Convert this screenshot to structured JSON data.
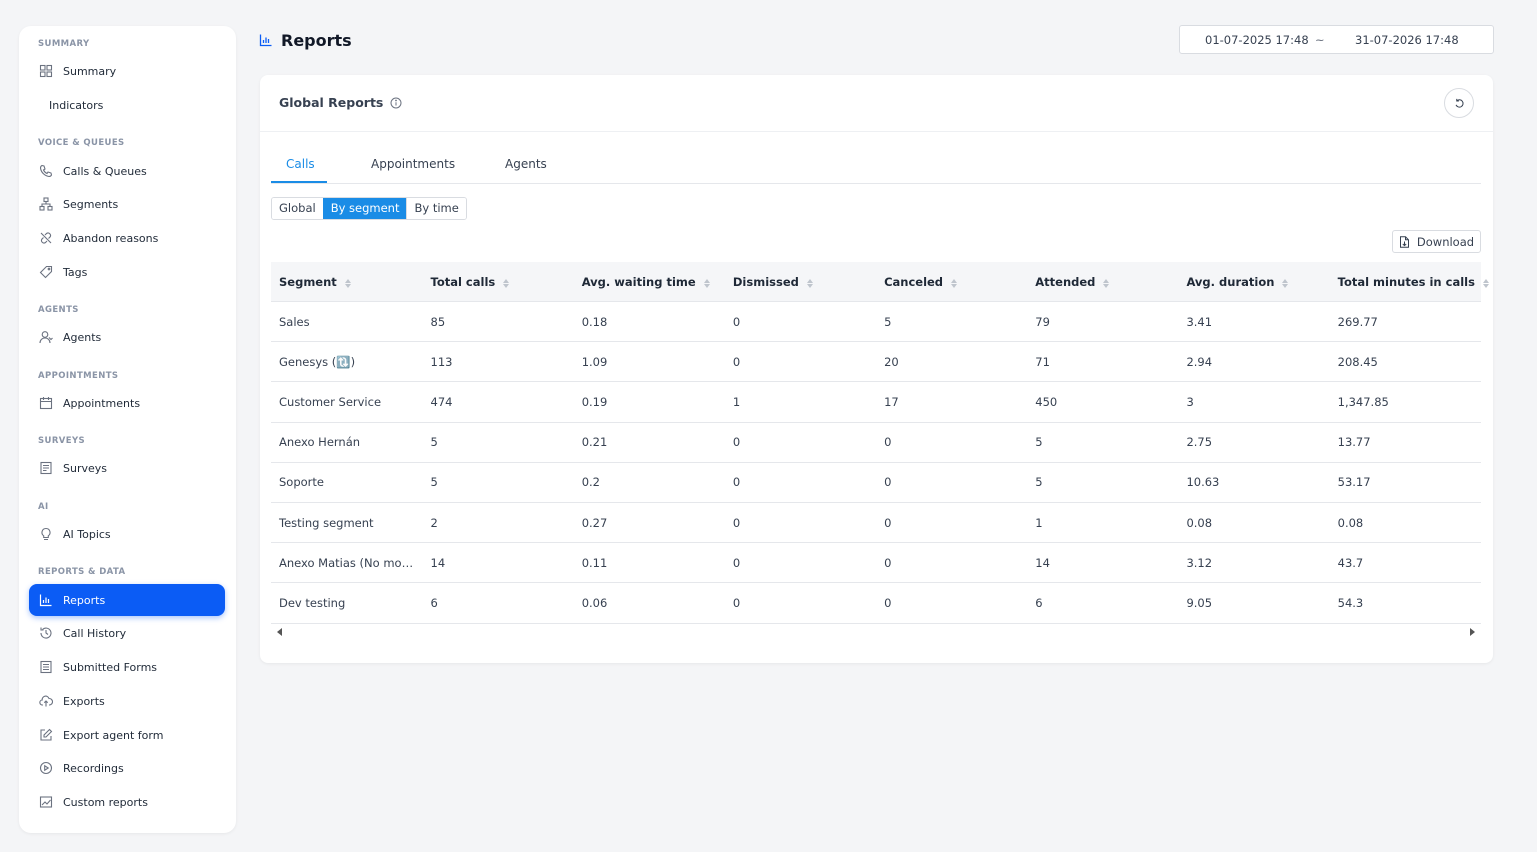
{
  "sidebar": {
    "sections": {
      "summary": "SUMMARY",
      "voice": "VOICE & QUEUES",
      "agents": "AGENTS",
      "appointments": "APPOINTMENTS",
      "surveys": "SURVEYS",
      "ai": "AI",
      "reports": "REPORTS & DATA"
    },
    "items": {
      "summary": "Summary",
      "indicators": "Indicators",
      "calls_queues": "Calls & Queues",
      "segments": "Segments",
      "abandon_reasons": "Abandon reasons",
      "tags": "Tags",
      "agents": "Agents",
      "appointments": "Appointments",
      "surveys": "Surveys",
      "ai_topics": "AI Topics",
      "reports": "Reports",
      "call_history": "Call History",
      "submitted_forms": "Submitted Forms",
      "exports": "Exports",
      "export_agent_form": "Export agent form",
      "recordings": "Recordings",
      "custom_reports": "Custom reports"
    },
    "active": "reports"
  },
  "header": {
    "title": "Reports",
    "date_from": "01-07-2025 17:48",
    "date_sep": "~",
    "date_to": "31-07-2026 17:48"
  },
  "card": {
    "title": "Global Reports",
    "tabs": [
      "Calls",
      "Appointments",
      "Agents"
    ],
    "active_tab": "Calls",
    "segmented": [
      "Global",
      "By segment",
      "By time"
    ],
    "active_segment": "By segment",
    "download_label": "Download"
  },
  "table": {
    "columns": [
      "Segment",
      "Total calls",
      "Avg. waiting time",
      "Dismissed",
      "Canceled",
      "Attended",
      "Avg. duration",
      "Total minutes in calls"
    ],
    "rows": [
      [
        "Sales",
        "85",
        "0.18",
        "0",
        "5",
        "79",
        "3.41",
        "269.77"
      ],
      [
        "Genesys (🔃)",
        "113",
        "1.09",
        "0",
        "20",
        "71",
        "2.94",
        "208.45"
      ],
      [
        "Customer Service",
        "474",
        "0.19",
        "1",
        "17",
        "450",
        "3",
        "1,347.85"
      ],
      [
        "Anexo Hernán",
        "5",
        "0.21",
        "0",
        "0",
        "5",
        "2.75",
        "13.77"
      ],
      [
        "Soporte",
        "5",
        "0.2",
        "0",
        "0",
        "5",
        "10.63",
        "53.17"
      ],
      [
        "Testing segment",
        "2",
        "0.27",
        "0",
        "0",
        "1",
        "0.08",
        "0.08"
      ],
      [
        "Anexo Matias (No mod...",
        "14",
        "0.11",
        "0",
        "0",
        "14",
        "3.12",
        "43.7"
      ],
      [
        "Dev testing",
        "6",
        "0.06",
        "0",
        "0",
        "6",
        "9.05",
        "54.3"
      ]
    ]
  },
  "colors": {
    "accent": "#0b5cf5",
    "tab_active": "#1a8ce6",
    "background": "#f4f5f7"
  }
}
